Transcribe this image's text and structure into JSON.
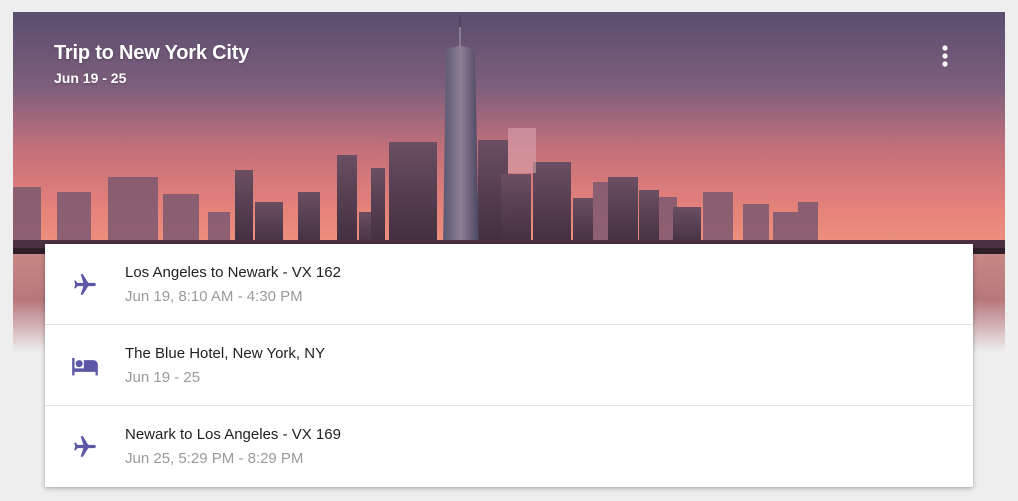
{
  "trip": {
    "title": "Trip to New York City",
    "dates": "Jun 19 - 25"
  },
  "header": {
    "more_icon": "more-vert-icon"
  },
  "colors": {
    "accent": "#5c57a6",
    "title_text": "#212121",
    "secondary_text": "#9a9a9a"
  },
  "items": [
    {
      "icon": "flight-icon",
      "title": "Los Angeles to Newark - VX 162",
      "subtitle": "Jun 19, 8:10 AM - 4:30 PM"
    },
    {
      "icon": "hotel-icon",
      "title": "The Blue Hotel, New York, NY",
      "subtitle": "Jun 19 - 25"
    },
    {
      "icon": "flight-icon",
      "title": "Newark to Los Angeles - VX 169",
      "subtitle": "Jun 25, 5:29 PM - 8:29 PM"
    }
  ]
}
